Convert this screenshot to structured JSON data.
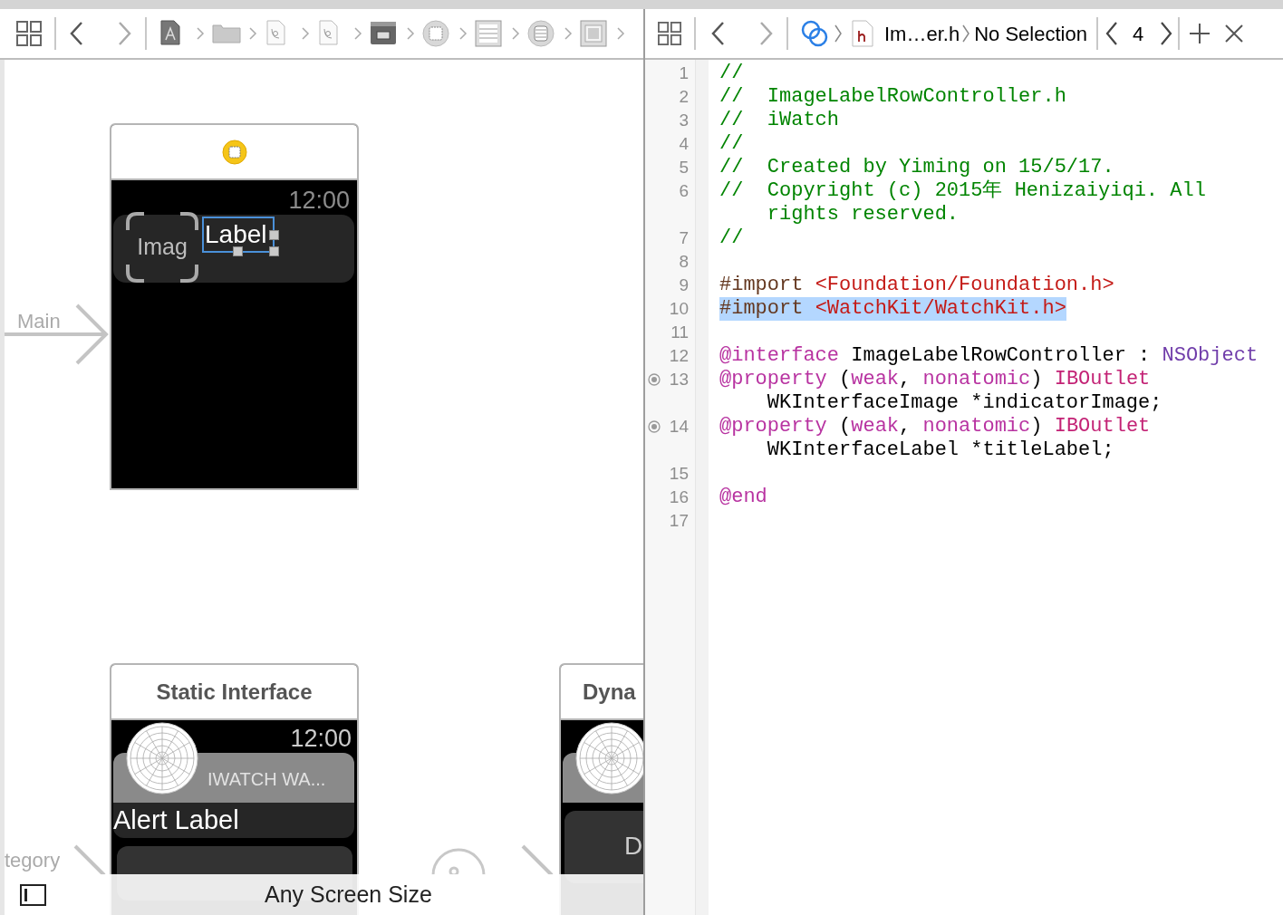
{
  "canvas": {
    "entry_label": "Main",
    "scene": {
      "time": "12:00",
      "image_placeholder": "Imag",
      "label": "Label",
      "label_selected": true
    },
    "static_interface": {
      "title": "Static Interface",
      "time": "12:00",
      "app_name": "IWATCH WA...",
      "alert_label": "Alert Label"
    },
    "category_label": "tegory",
    "dynamic_interface": {
      "title": "Dyna",
      "button": "D"
    }
  },
  "size_bar": {
    "label": "Any Screen Size"
  },
  "jump_bar": {
    "file": "Im…er.h",
    "selection": "No Selection",
    "counter": "4"
  },
  "code": {
    "lines": [
      {
        "number": "1",
        "outlet": false,
        "selected": false,
        "rows": [
          [
            {
              "kind": "comment",
              "text": "//"
            }
          ]
        ]
      },
      {
        "number": "2",
        "outlet": false,
        "selected": false,
        "rows": [
          [
            {
              "kind": "comment",
              "text": "//  ImageLabelRowController.h"
            }
          ]
        ]
      },
      {
        "number": "3",
        "outlet": false,
        "selected": false,
        "rows": [
          [
            {
              "kind": "comment",
              "text": "//  iWatch"
            }
          ]
        ]
      },
      {
        "number": "4",
        "outlet": false,
        "selected": false,
        "rows": [
          [
            {
              "kind": "comment",
              "text": "//"
            }
          ]
        ]
      },
      {
        "number": "5",
        "outlet": false,
        "selected": false,
        "rows": [
          [
            {
              "kind": "comment",
              "text": "//  Created by Yiming on 15/5/17."
            }
          ]
        ]
      },
      {
        "number": "6",
        "outlet": false,
        "selected": false,
        "rows": [
          [
            {
              "kind": "comment",
              "text": "//  Copyright (c) 2015年 Henizaiyiqi. All"
            }
          ],
          [
            {
              "kind": "comment",
              "text": "rights reserved."
            }
          ]
        ]
      },
      {
        "number": "7",
        "outlet": false,
        "selected": false,
        "rows": [
          [
            {
              "kind": "comment",
              "text": "//"
            }
          ]
        ]
      },
      {
        "number": "8",
        "outlet": false,
        "selected": false,
        "rows": [
          []
        ]
      },
      {
        "number": "9",
        "outlet": false,
        "selected": false,
        "rows": [
          [
            {
              "kind": "preprocessor",
              "text": "#import "
            },
            {
              "kind": "string",
              "text": "<Foundation/Foundation.h>"
            }
          ]
        ]
      },
      {
        "number": "10",
        "outlet": false,
        "selected": true,
        "rows": [
          [
            {
              "kind": "preprocessor",
              "text": "#import "
            },
            {
              "kind": "string",
              "text": "<WatchKit/WatchKit.h>"
            }
          ]
        ]
      },
      {
        "number": "11",
        "outlet": false,
        "selected": false,
        "rows": [
          []
        ]
      },
      {
        "number": "12",
        "outlet": false,
        "selected": false,
        "rows": [
          [
            {
              "kind": "keyword",
              "text": "@interface"
            },
            {
              "kind": "plain",
              "text": " ImageLabelRowController : "
            },
            {
              "kind": "type",
              "text": "NSObject"
            }
          ]
        ]
      },
      {
        "number": "13",
        "outlet": true,
        "selected": false,
        "rows": [
          [
            {
              "kind": "keyword",
              "text": "@property"
            },
            {
              "kind": "plain",
              "text": " ("
            },
            {
              "kind": "keyword",
              "text": "weak"
            },
            {
              "kind": "plain",
              "text": ", "
            },
            {
              "kind": "keyword",
              "text": "nonatomic"
            },
            {
              "kind": "plain",
              "text": ") "
            },
            {
              "kind": "macro",
              "text": "IBOutlet"
            }
          ],
          [
            {
              "kind": "plain",
              "text": "WKInterfaceImage *indicatorImage;"
            }
          ]
        ]
      },
      {
        "number": "14",
        "outlet": true,
        "selected": false,
        "rows": [
          [
            {
              "kind": "keyword",
              "text": "@property"
            },
            {
              "kind": "plain",
              "text": " ("
            },
            {
              "kind": "keyword",
              "text": "weak"
            },
            {
              "kind": "plain",
              "text": ", "
            },
            {
              "kind": "keyword",
              "text": "nonatomic"
            },
            {
              "kind": "plain",
              "text": ") "
            },
            {
              "kind": "macro",
              "text": "IBOutlet"
            }
          ],
          [
            {
              "kind": "plain",
              "text": "WKInterfaceLabel *titleLabel;"
            }
          ]
        ]
      },
      {
        "number": "15",
        "outlet": false,
        "selected": false,
        "rows": [
          []
        ]
      },
      {
        "number": "16",
        "outlet": false,
        "selected": false,
        "rows": [
          [
            {
              "kind": "keyword",
              "text": "@end"
            }
          ]
        ]
      },
      {
        "number": "17",
        "outlet": false,
        "selected": false,
        "rows": [
          []
        ]
      }
    ]
  }
}
